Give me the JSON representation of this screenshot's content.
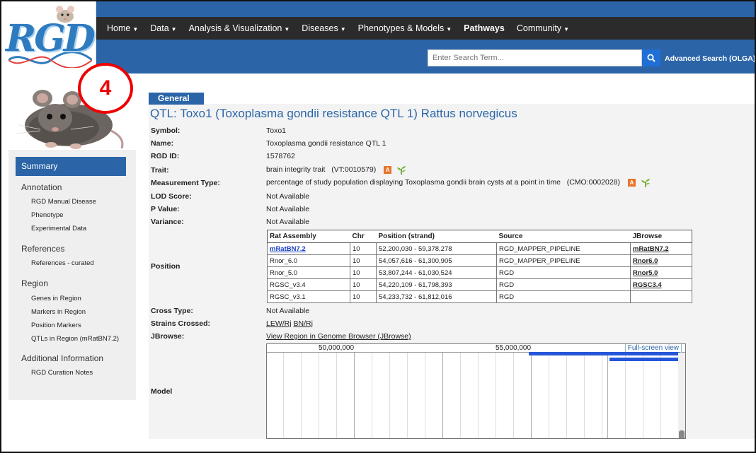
{
  "logo": {
    "text": "RGD"
  },
  "nav": {
    "items": [
      {
        "label": "Home",
        "dropdown": true
      },
      {
        "label": "Data",
        "dropdown": true
      },
      {
        "label": "Analysis & Visualization",
        "dropdown": true
      },
      {
        "label": "Diseases",
        "dropdown": true
      },
      {
        "label": "Phenotypes & Models",
        "dropdown": true
      },
      {
        "label": "Pathways",
        "dropdown": false
      },
      {
        "label": "Community",
        "dropdown": true
      }
    ]
  },
  "search": {
    "placeholder": "Enter Search Term...",
    "advanced_label": "Advanced Search (OLGA)"
  },
  "annotation_badge": "4",
  "sidebar": {
    "summary": "Summary",
    "sections": [
      {
        "title": "Annotation",
        "items": [
          "RGD Manual Disease",
          "Phenotype",
          "Experimental Data"
        ]
      },
      {
        "title": "References",
        "items": [
          "References - curated"
        ]
      },
      {
        "title": "Region",
        "items": [
          "Genes in Region",
          "Markers in Region",
          "Position Markers",
          "QTLs in Region (mRatBN7.2)"
        ]
      },
      {
        "title": "Additional Information",
        "items": [
          "RGD Curation Notes"
        ]
      }
    ]
  },
  "general_tab": "General",
  "qtl": {
    "title": "QTL: Toxo1 (Toxoplasma gondii resistance QTL 1) Rattus norvegicus",
    "symbol_label": "Symbol:",
    "symbol": "Toxo1",
    "name_label": "Name:",
    "name": "Toxoplasma gondii resistance QTL 1",
    "rgdid_label": "RGD ID:",
    "rgdid": "1578762",
    "trait_label": "Trait:",
    "trait": "brain integrity trait   (VT:0010579)",
    "measurement_label": "Measurement Type:",
    "measurement": "percentage of study population displaying Toxoplasma gondii brain cysts at a point in time   (CMO:0002028)",
    "lod_label": "LOD Score:",
    "lod": "Not Available",
    "pvalue_label": "P Value:",
    "pvalue": "Not Available",
    "variance_label": "Variance:",
    "variance": "Not Available",
    "position_label": "Position",
    "cross_label": "Cross Type:",
    "cross": "Not Available",
    "strains_label": "Strains Crossed:",
    "strain1": "LEW/Rj",
    "strain2": "BN/Rj",
    "jbrowse_label": "JBrowse:",
    "jbrowse_link": "View Region in Genome Browser (JBrowse)",
    "model_label": "Model",
    "icon_a": "A"
  },
  "position_table": {
    "headers": [
      "Rat Assembly",
      "Chr",
      "Position (strand)",
      "Source",
      "JBrowse"
    ],
    "rows": [
      [
        "mRatBN7.2",
        "10",
        "52,200,030 - 59,378,278",
        "RGD_MAPPER_PIPELINE",
        "mRatBN7.2"
      ],
      [
        "Rnor_6.0",
        "10",
        "54,057,616 - 61,300,905",
        "RGD_MAPPER_PIPELINE",
        "Rnor6.0"
      ],
      [
        "Rnor_5.0",
        "10",
        "53,807,244 - 61,030,524",
        "RGD",
        "Rnor5.0"
      ],
      [
        "RGSC_v3.4",
        "10",
        "54,220,109 - 61,798,393",
        "RGD",
        "RGSC3.4"
      ],
      [
        "RGSC_v3.1",
        "10",
        "54,233,732 - 61,812,016",
        "RGD",
        ""
      ]
    ]
  },
  "jbrowse_view": {
    "tick1": "50,000,000",
    "tick2": "55,000,000",
    "fullscreen": "Full-screen view"
  }
}
